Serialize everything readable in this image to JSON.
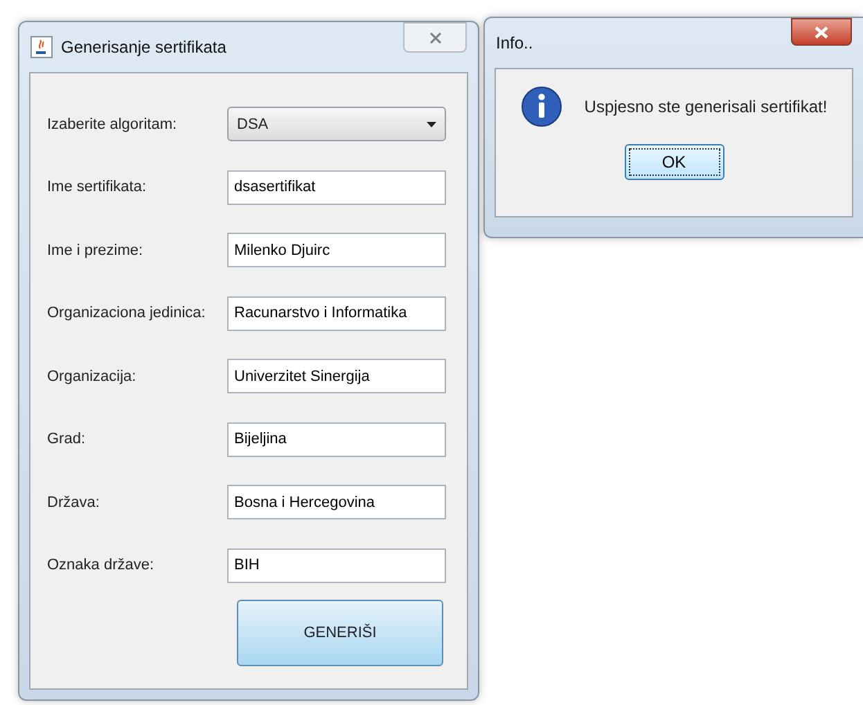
{
  "main_window": {
    "title": "Generisanje sertifikata",
    "fields": [
      {
        "kind": "dropdown",
        "label": "Izaberite algoritam:",
        "value": "DSA"
      },
      {
        "kind": "text",
        "label": "Ime sertifikata:",
        "value": "dsasertifikat"
      },
      {
        "kind": "text",
        "label": "Ime i prezime:",
        "value": "Milenko Djuirc"
      },
      {
        "kind": "text",
        "label": "Organizaciona jedinica:",
        "value": "Racunarstvo i Informatika"
      },
      {
        "kind": "text",
        "label": "Organizacija:",
        "value": "Univerzitet Sinergija"
      },
      {
        "kind": "text",
        "label": "Grad:",
        "value": "Bijeljina"
      },
      {
        "kind": "text",
        "label": "Država:",
        "value": "Bosna i Hercegovina"
      },
      {
        "kind": "text",
        "label": "Oznaka države:",
        "value": "BIH"
      }
    ],
    "button": "GENERIŠI"
  },
  "info_dialog": {
    "title": "Info..",
    "message": "Uspjesno ste generisali sertifikat!",
    "button": "OK"
  }
}
